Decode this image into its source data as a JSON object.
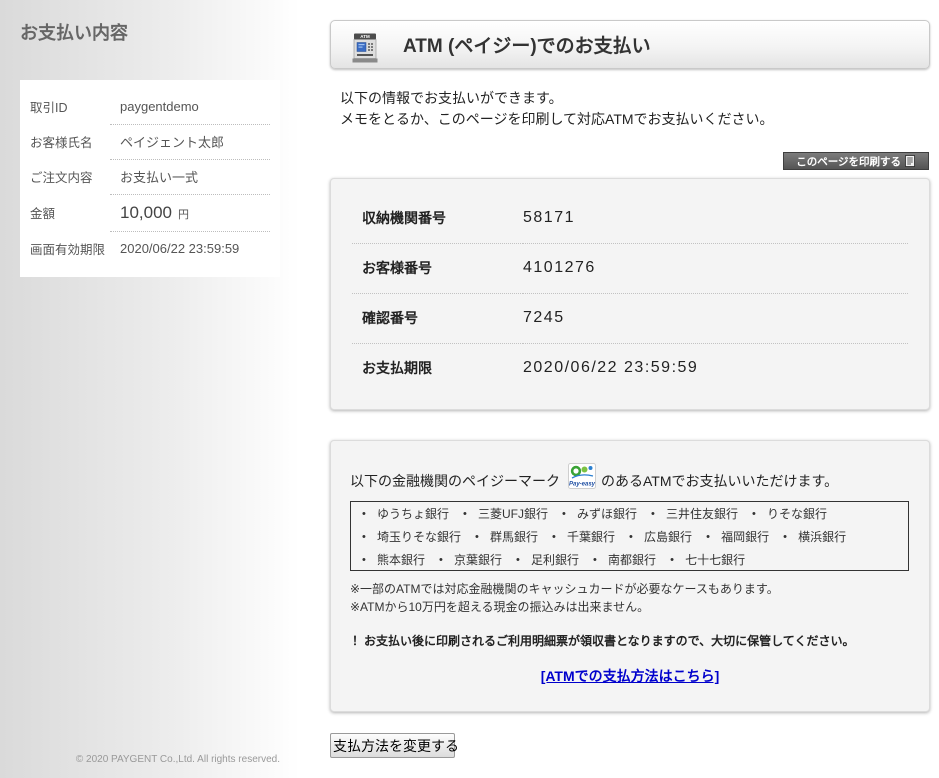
{
  "sidebar": {
    "title": "お支払い内容",
    "rows": [
      {
        "label": "取引ID",
        "value": "paygentdemo"
      },
      {
        "label": "お客様氏名",
        "value": "ペイジェント太郎"
      },
      {
        "label": "ご注文内容",
        "value": "お支払い一式"
      },
      {
        "label": "金額",
        "value": "10,000",
        "unit": "円"
      },
      {
        "label": "画面有効期限",
        "value": "2020/06/22 23:59:59"
      }
    ],
    "copyright": "© 2020 PAYGENT Co.,Ltd. All rights reserved."
  },
  "header": {
    "title": "ATM (ペイジー)でのお支払い",
    "icon": "atm-icon",
    "icon_label": "ATM"
  },
  "intro": [
    "以下の情報でお支払いができます。",
    "メモをとるか、このページを印刷して対応ATMでお支払いください。"
  ],
  "print_button": {
    "label": "このページを印刷する",
    "icon": "document-icon"
  },
  "payment_info": [
    {
      "label": "収納機関番号",
      "value": "58171"
    },
    {
      "label": "お客様番号",
      "value": "4101276"
    },
    {
      "label": "確認番号",
      "value": "7245"
    },
    {
      "label": "お支払期限",
      "value": "2020/06/22 23:59:59"
    }
  ],
  "banks": {
    "intro_before": "以下の金融機関のペイジーマーク",
    "intro_after": "のあるATMでお支払いいただけます。",
    "mark_icon": "pay-easy-logo",
    "mark_label": "Pay-easy",
    "list": [
      "ゆうちょ銀行",
      "三菱UFJ銀行",
      "みずほ銀行",
      "三井住友銀行",
      "りそな銀行",
      "埼玉りそな銀行",
      "群馬銀行",
      "千葉銀行",
      "広島銀行",
      "福岡銀行",
      "横浜銀行",
      "熊本銀行",
      "京葉銀行",
      "足利銀行",
      "南都銀行",
      "七十七銀行"
    ]
  },
  "notes": [
    "※一部のATMでは対応金融機関のキャッシュカードが必要なケースもあります。",
    "※ATMから10万円を超える現金の振込みは出来ません。"
  ],
  "important_note": "！お支払い後に印刷されるご利用明細票が領収書となりますので、大切に保管してください。",
  "help_link": "[ATMでの支払方法はこちら]",
  "change_method_button": "支払方法を変更する",
  "colors": {
    "link": "#0000cc",
    "print_button": "#5c5c5c",
    "panel_background": "#f4f4f4",
    "sidebar_gradient_start": "#dadada"
  }
}
